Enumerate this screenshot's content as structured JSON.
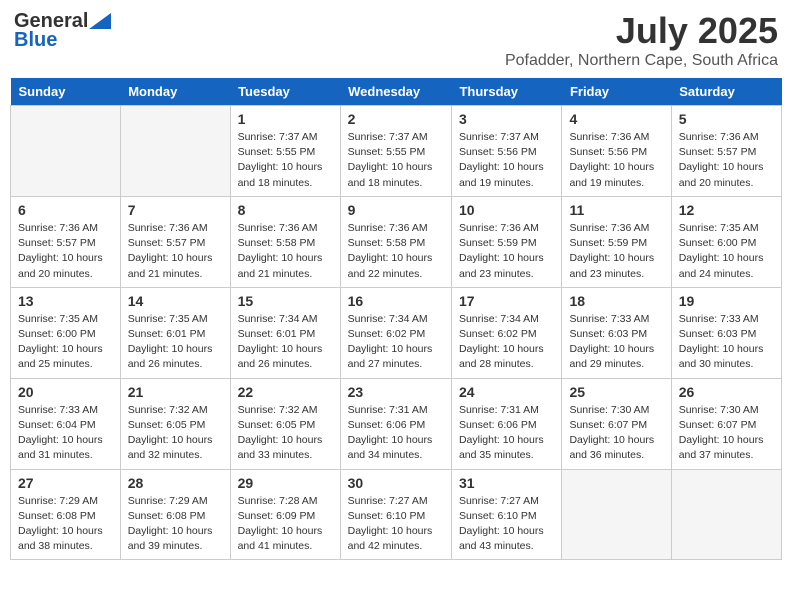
{
  "logo": {
    "general": "General",
    "blue": "Blue"
  },
  "title": {
    "month_year": "July 2025",
    "location": "Pofadder, Northern Cape, South Africa"
  },
  "days_of_week": [
    "Sunday",
    "Monday",
    "Tuesday",
    "Wednesday",
    "Thursday",
    "Friday",
    "Saturday"
  ],
  "weeks": [
    [
      {
        "num": "",
        "sunrise": "",
        "sunset": "",
        "daylight": "",
        "empty": true
      },
      {
        "num": "",
        "sunrise": "",
        "sunset": "",
        "daylight": "",
        "empty": true
      },
      {
        "num": "1",
        "sunrise": "Sunrise: 7:37 AM",
        "sunset": "Sunset: 5:55 PM",
        "daylight": "Daylight: 10 hours and 18 minutes."
      },
      {
        "num": "2",
        "sunrise": "Sunrise: 7:37 AM",
        "sunset": "Sunset: 5:55 PM",
        "daylight": "Daylight: 10 hours and 18 minutes."
      },
      {
        "num": "3",
        "sunrise": "Sunrise: 7:37 AM",
        "sunset": "Sunset: 5:56 PM",
        "daylight": "Daylight: 10 hours and 19 minutes."
      },
      {
        "num": "4",
        "sunrise": "Sunrise: 7:36 AM",
        "sunset": "Sunset: 5:56 PM",
        "daylight": "Daylight: 10 hours and 19 minutes."
      },
      {
        "num": "5",
        "sunrise": "Sunrise: 7:36 AM",
        "sunset": "Sunset: 5:57 PM",
        "daylight": "Daylight: 10 hours and 20 minutes."
      }
    ],
    [
      {
        "num": "6",
        "sunrise": "Sunrise: 7:36 AM",
        "sunset": "Sunset: 5:57 PM",
        "daylight": "Daylight: 10 hours and 20 minutes."
      },
      {
        "num": "7",
        "sunrise": "Sunrise: 7:36 AM",
        "sunset": "Sunset: 5:57 PM",
        "daylight": "Daylight: 10 hours and 21 minutes."
      },
      {
        "num": "8",
        "sunrise": "Sunrise: 7:36 AM",
        "sunset": "Sunset: 5:58 PM",
        "daylight": "Daylight: 10 hours and 21 minutes."
      },
      {
        "num": "9",
        "sunrise": "Sunrise: 7:36 AM",
        "sunset": "Sunset: 5:58 PM",
        "daylight": "Daylight: 10 hours and 22 minutes."
      },
      {
        "num": "10",
        "sunrise": "Sunrise: 7:36 AM",
        "sunset": "Sunset: 5:59 PM",
        "daylight": "Daylight: 10 hours and 23 minutes."
      },
      {
        "num": "11",
        "sunrise": "Sunrise: 7:36 AM",
        "sunset": "Sunset: 5:59 PM",
        "daylight": "Daylight: 10 hours and 23 minutes."
      },
      {
        "num": "12",
        "sunrise": "Sunrise: 7:35 AM",
        "sunset": "Sunset: 6:00 PM",
        "daylight": "Daylight: 10 hours and 24 minutes."
      }
    ],
    [
      {
        "num": "13",
        "sunrise": "Sunrise: 7:35 AM",
        "sunset": "Sunset: 6:00 PM",
        "daylight": "Daylight: 10 hours and 25 minutes."
      },
      {
        "num": "14",
        "sunrise": "Sunrise: 7:35 AM",
        "sunset": "Sunset: 6:01 PM",
        "daylight": "Daylight: 10 hours and 26 minutes."
      },
      {
        "num": "15",
        "sunrise": "Sunrise: 7:34 AM",
        "sunset": "Sunset: 6:01 PM",
        "daylight": "Daylight: 10 hours and 26 minutes."
      },
      {
        "num": "16",
        "sunrise": "Sunrise: 7:34 AM",
        "sunset": "Sunset: 6:02 PM",
        "daylight": "Daylight: 10 hours and 27 minutes."
      },
      {
        "num": "17",
        "sunrise": "Sunrise: 7:34 AM",
        "sunset": "Sunset: 6:02 PM",
        "daylight": "Daylight: 10 hours and 28 minutes."
      },
      {
        "num": "18",
        "sunrise": "Sunrise: 7:33 AM",
        "sunset": "Sunset: 6:03 PM",
        "daylight": "Daylight: 10 hours and 29 minutes."
      },
      {
        "num": "19",
        "sunrise": "Sunrise: 7:33 AM",
        "sunset": "Sunset: 6:03 PM",
        "daylight": "Daylight: 10 hours and 30 minutes."
      }
    ],
    [
      {
        "num": "20",
        "sunrise": "Sunrise: 7:33 AM",
        "sunset": "Sunset: 6:04 PM",
        "daylight": "Daylight: 10 hours and 31 minutes."
      },
      {
        "num": "21",
        "sunrise": "Sunrise: 7:32 AM",
        "sunset": "Sunset: 6:05 PM",
        "daylight": "Daylight: 10 hours and 32 minutes."
      },
      {
        "num": "22",
        "sunrise": "Sunrise: 7:32 AM",
        "sunset": "Sunset: 6:05 PM",
        "daylight": "Daylight: 10 hours and 33 minutes."
      },
      {
        "num": "23",
        "sunrise": "Sunrise: 7:31 AM",
        "sunset": "Sunset: 6:06 PM",
        "daylight": "Daylight: 10 hours and 34 minutes."
      },
      {
        "num": "24",
        "sunrise": "Sunrise: 7:31 AM",
        "sunset": "Sunset: 6:06 PM",
        "daylight": "Daylight: 10 hours and 35 minutes."
      },
      {
        "num": "25",
        "sunrise": "Sunrise: 7:30 AM",
        "sunset": "Sunset: 6:07 PM",
        "daylight": "Daylight: 10 hours and 36 minutes."
      },
      {
        "num": "26",
        "sunrise": "Sunrise: 7:30 AM",
        "sunset": "Sunset: 6:07 PM",
        "daylight": "Daylight: 10 hours and 37 minutes."
      }
    ],
    [
      {
        "num": "27",
        "sunrise": "Sunrise: 7:29 AM",
        "sunset": "Sunset: 6:08 PM",
        "daylight": "Daylight: 10 hours and 38 minutes."
      },
      {
        "num": "28",
        "sunrise": "Sunrise: 7:29 AM",
        "sunset": "Sunset: 6:08 PM",
        "daylight": "Daylight: 10 hours and 39 minutes."
      },
      {
        "num": "29",
        "sunrise": "Sunrise: 7:28 AM",
        "sunset": "Sunset: 6:09 PM",
        "daylight": "Daylight: 10 hours and 41 minutes."
      },
      {
        "num": "30",
        "sunrise": "Sunrise: 7:27 AM",
        "sunset": "Sunset: 6:10 PM",
        "daylight": "Daylight: 10 hours and 42 minutes."
      },
      {
        "num": "31",
        "sunrise": "Sunrise: 7:27 AM",
        "sunset": "Sunset: 6:10 PM",
        "daylight": "Daylight: 10 hours and 43 minutes."
      },
      {
        "num": "",
        "sunrise": "",
        "sunset": "",
        "daylight": "",
        "empty": true
      },
      {
        "num": "",
        "sunrise": "",
        "sunset": "",
        "daylight": "",
        "empty": true
      }
    ]
  ]
}
